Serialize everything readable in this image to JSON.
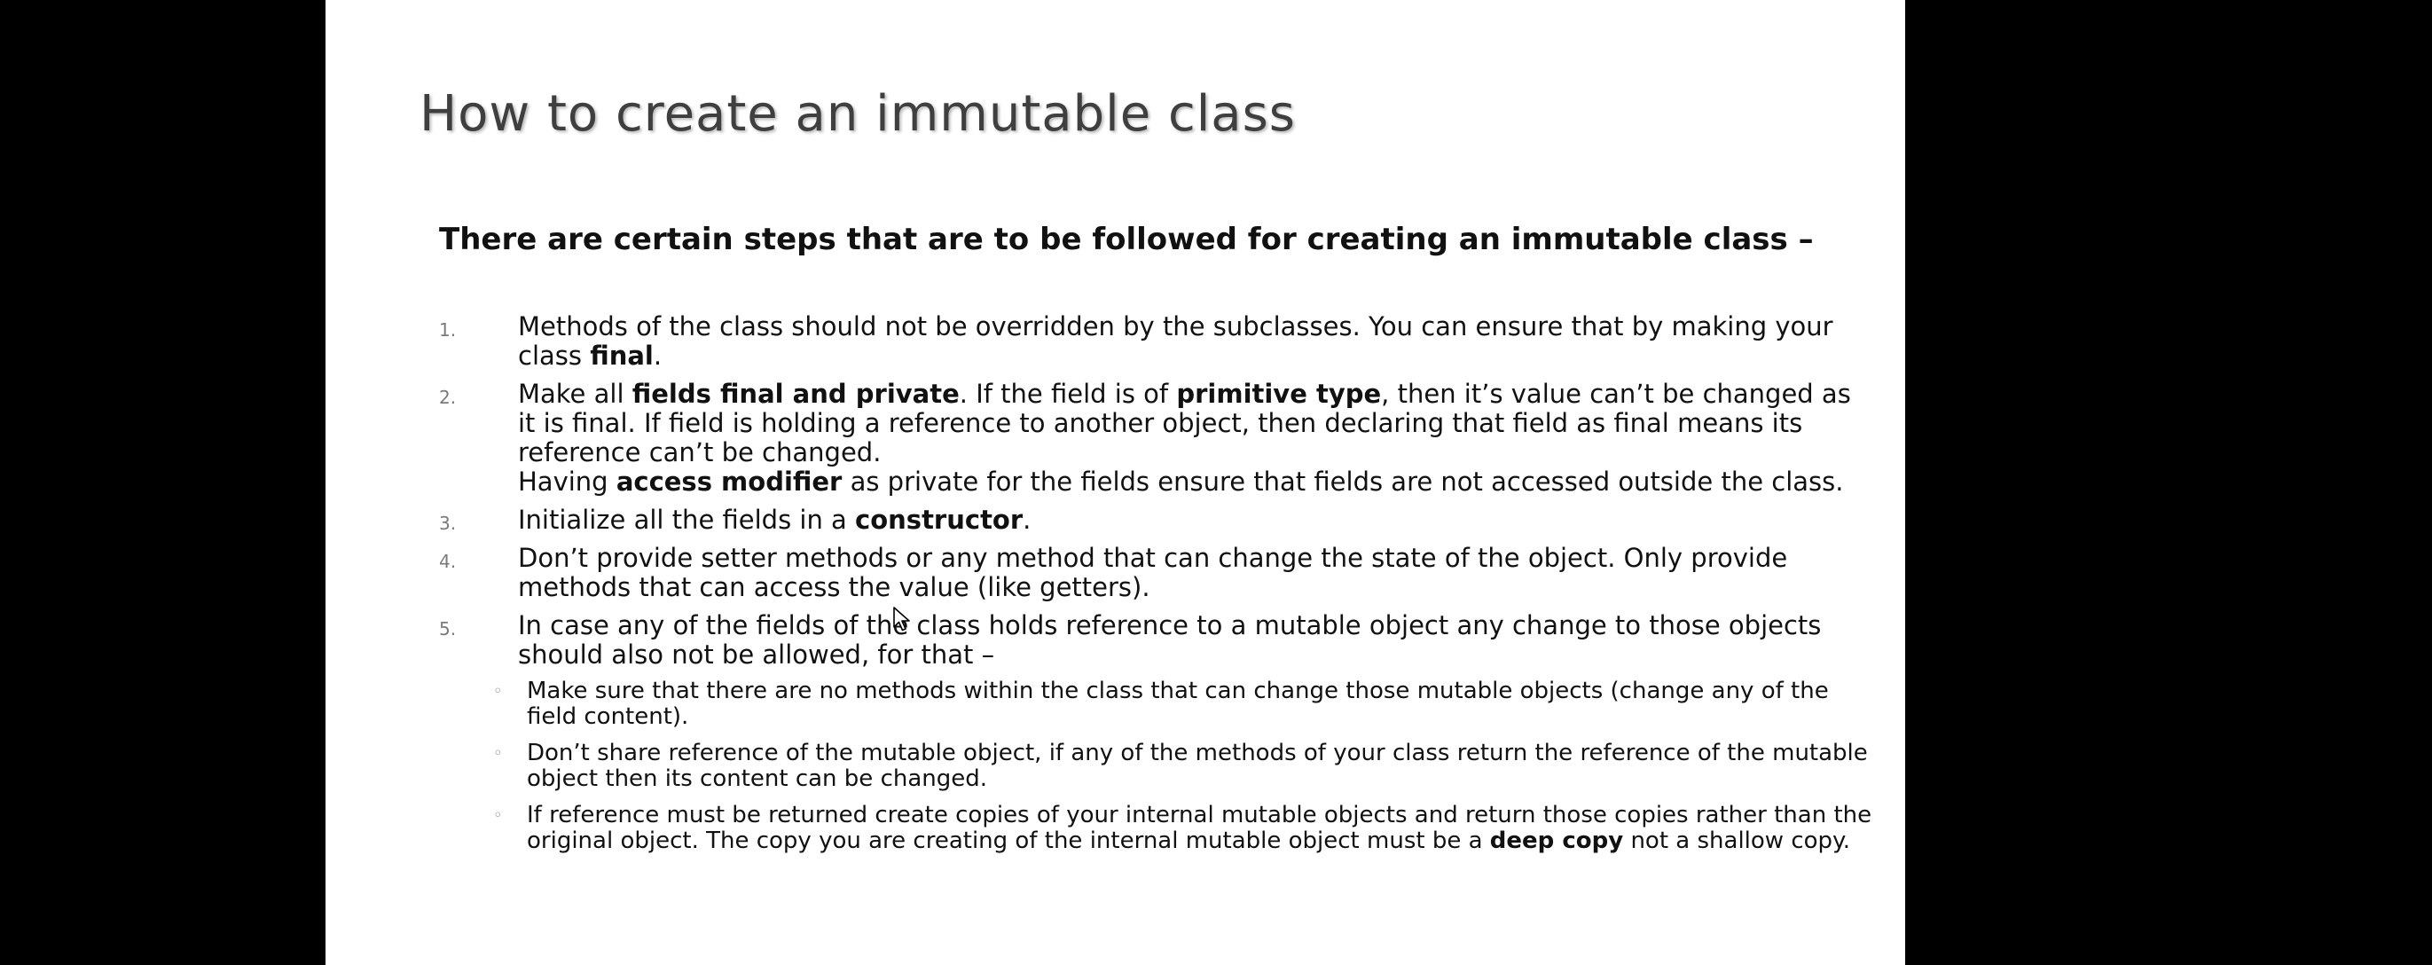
{
  "slide": {
    "title": "How to create an immutable class",
    "intro": "There are certain steps that are to be followed for creating an immutable class –",
    "steps": [
      {
        "number": "1.",
        "text_a": "Methods of the class should not be overridden by the subclasses. You can ensure that by making your class ",
        "bold_a": "final",
        "text_b": "."
      },
      {
        "number": "2.",
        "text_a": "Make all ",
        "bold_a": "fields final and private",
        "text_b": ". If the field is of ",
        "bold_b": "primitive type",
        "text_c": ", then it’s value can’t be changed as it is final. If field is holding a reference to another object, then declaring that field as final means its reference can’t be changed.",
        "text_d": "Having ",
        "bold_c": "access modifier",
        "text_e": " as private for the fields ensure that fields are not accessed outside the class."
      },
      {
        "number": "3.",
        "text_a": "Initialize all the fields in a ",
        "bold_a": "constructor",
        "text_b": "."
      },
      {
        "number": "4.",
        "text_a": "Don’t provide setter methods or any method that can change the state of the object. Only provide methods that can access the value (like getters)."
      },
      {
        "number": "5.",
        "text_a": "In case any of the fields of the class holds reference to a mutable object any change to those objects should also not be allowed, for that –",
        "sub": [
          {
            "bullet": "◦",
            "text_a": "Make sure that there are no methods within the class that can change those mutable objects (change any of the field content)."
          },
          {
            "bullet": "◦",
            "text_a": "Don’t share reference of the mutable object, if any of the methods of your class return the reference of the mutable object then its content can be changed."
          },
          {
            "bullet": "◦",
            "text_a": "If reference must be returned create copies of your internal mutable objects and return those copies rather than the original object. The copy you are creating of the internal mutable object must be a ",
            "bold_a": "deep copy",
            "text_b": " not a shallow copy."
          }
        ]
      }
    ]
  },
  "colors": {
    "background": "#000000",
    "slide": "#ffffff",
    "title": "#3f3f3f",
    "text": "#111111",
    "number": "#7a7a7a"
  },
  "cursor": {
    "icon": "mouse-pointer-icon"
  }
}
